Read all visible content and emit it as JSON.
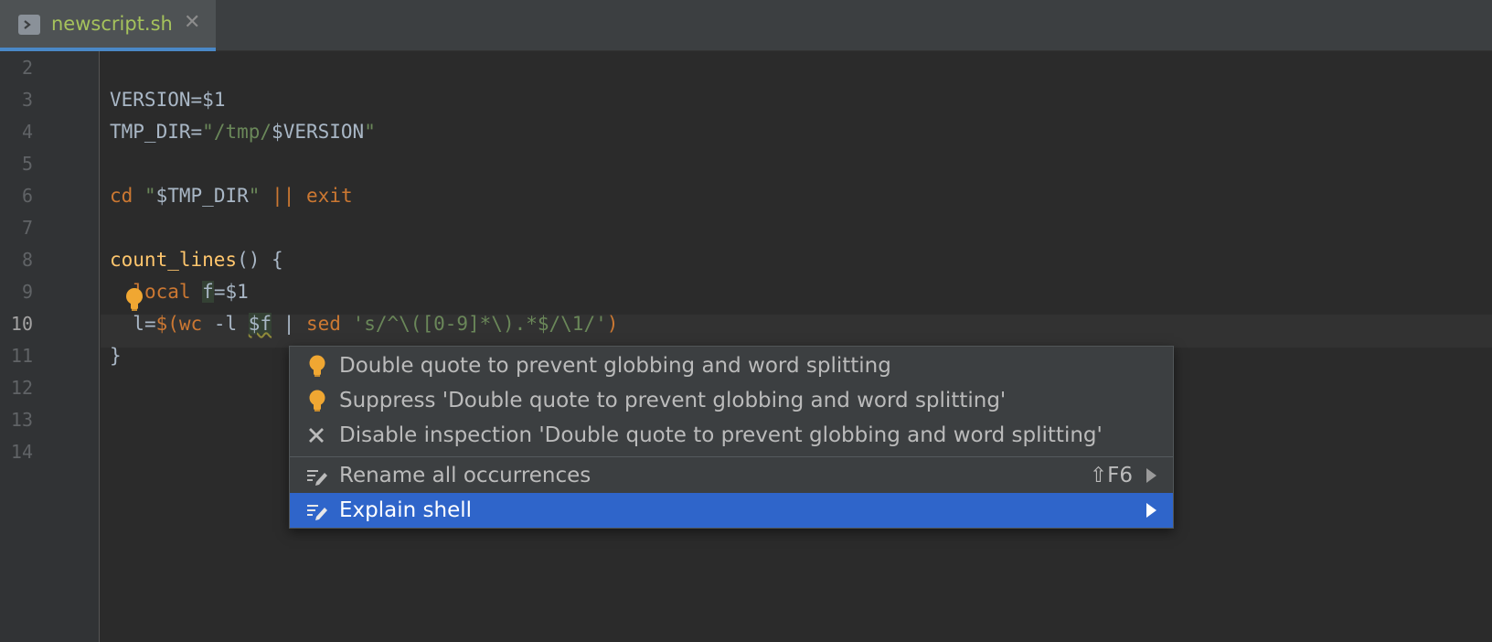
{
  "tab": {
    "title": "newscript.sh",
    "close": "✕",
    "icon": "terminal-icon"
  },
  "gutter": {
    "line_numbers": [
      "2",
      "3",
      "4",
      "5",
      "6",
      "7",
      "8",
      "9",
      "10",
      "11",
      "12",
      "13",
      "14"
    ],
    "current_line": "10"
  },
  "code": {
    "line3": {
      "name": "VERSION",
      "op": "=",
      "val": "$1"
    },
    "line4": {
      "name": "TMP_DIR",
      "op": "=",
      "q1": "\"",
      "path": "/tmp/",
      "var": "$VERSION",
      "q2": "\""
    },
    "line6": {
      "cmd": "cd",
      "q1": "\"",
      "var": "$TMP_DIR",
      "q2": "\"",
      "or": "||",
      "exit": "exit"
    },
    "line8": {
      "fn": "count_lines",
      "rest": "() {"
    },
    "line9": {
      "kw": "local",
      "var": "f",
      "rest": "=$1"
    },
    "line10": {
      "a": "l=",
      "sub": "$(",
      "wc": "wc",
      "flag": " -l ",
      "var": "$f",
      "pipe": " | ",
      "sed": "sed",
      "sp": " ",
      "pattern": "'s/^\\([0-9]*\\).*$/\\1/'",
      "close": ")"
    },
    "line11": {
      "text": "}"
    }
  },
  "popup": {
    "items": [
      {
        "icon": "bulb-icon",
        "label": "Double quote to prevent globbing and word splitting"
      },
      {
        "icon": "bulb-icon",
        "label": "Suppress 'Double quote to prevent globbing and word splitting'"
      },
      {
        "icon": "close-icon",
        "label": "Disable inspection 'Double quote to prevent globbing and word splitting'"
      },
      {
        "icon": "edit-icon",
        "label": "Rename all occurrences",
        "shortcut": "⇧F6",
        "has_submenu": true
      },
      {
        "icon": "edit-icon",
        "label": "Explain shell",
        "has_submenu": true,
        "selected": true
      }
    ]
  },
  "colors": {
    "background": "#2b2b2b",
    "selection": "#2f65ca",
    "keyword": "#cc7832",
    "string": "#6a8759",
    "function": "#ffc66d",
    "bulb": "#f0a732"
  }
}
